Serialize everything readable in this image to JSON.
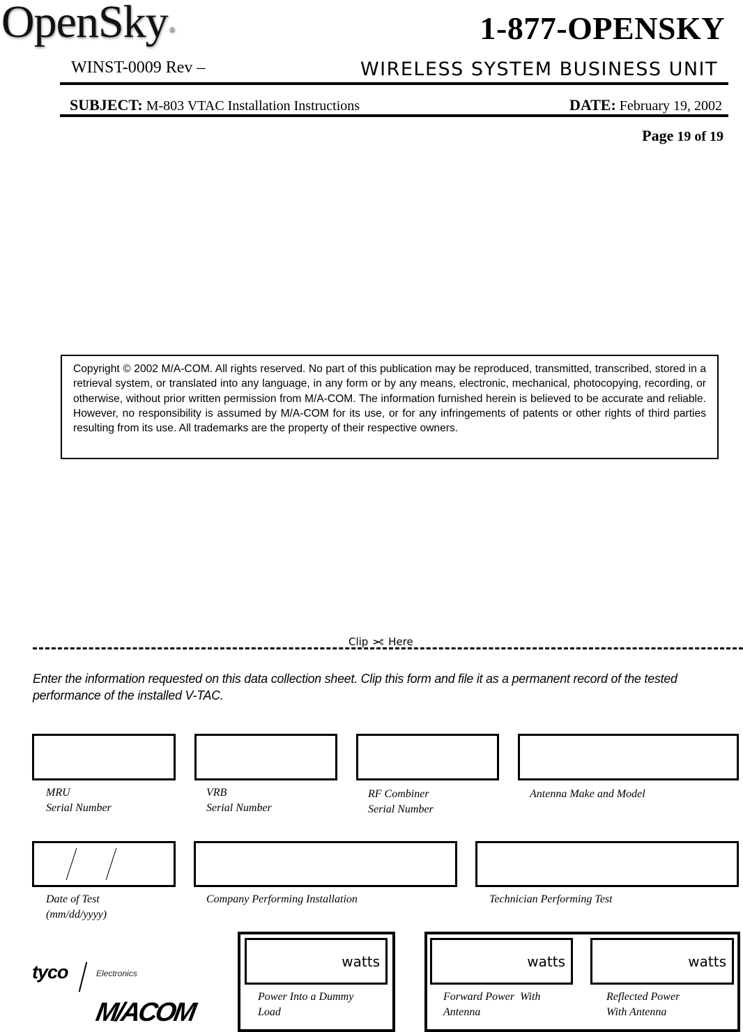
{
  "header": {
    "logo_text": "OpenSky",
    "logo_mark": "®",
    "phone": "1-877-OPENSKY",
    "doc_number": "WINST-0009 Rev –",
    "business_unit": "WIRELESS SYSTEM BUSINESS UNIT",
    "subject_label": "SUBJECT:",
    "subject_value": "M-803 VTAC Installation Instructions",
    "date_label": "DATE:",
    "date_value": "February 19, 2002",
    "page_label": "Page",
    "page_current": "19",
    "page_of": "of",
    "page_total": "19"
  },
  "copyright": {
    "text": "Copyright © 2002 M/A-COM. All rights reserved. No part of this publication may be reproduced, transmitted, transcribed, stored in a retrieval system, or translated into any language, in any form or by any means, electronic, mechanical, photocopying, recording, or otherwise, without prior written permission from M/A-COM. The information furnished herein is believed to be accurate and reliable. However, no responsibility is assumed by M/A-COM for its use, or for any infringements of patents or other rights of third parties resulting from its use. All trademarks are the property of their respective owners."
  },
  "clip": {
    "left": "Clip",
    "icon": "scissors-icon",
    "glyph": "✂",
    "right": "Here"
  },
  "instructions": "Enter the information requested on this data collection sheet. Clip this form and file it as a permanent record of the tested performance of the installed V-TAC.",
  "form": {
    "row1": [
      {
        "label_line1": "MRU",
        "label_line2": "Serial Number",
        "value": ""
      },
      {
        "label_line1": "VRB",
        "label_line2": "Serial Number",
        "value": ""
      },
      {
        "label_line1": "RF Combiner",
        "label_line2": "Serial Number",
        "value": ""
      },
      {
        "label_line1": "Antenna Make and Model",
        "label_line2": "",
        "value": ""
      }
    ],
    "row2": [
      {
        "label_line1": "Date of Test",
        "label_line2": "(mm/dd/yyyy)",
        "value": ""
      },
      {
        "label_line1": "Company Performing Installation",
        "label_line2": "",
        "value": ""
      },
      {
        "label_line1": "Technician Performing Test",
        "label_line2": "",
        "value": ""
      }
    ],
    "power": [
      {
        "unit": "watts",
        "label_line1": "Power Into a Dummy",
        "label_line2": "Load",
        "value": ""
      },
      {
        "unit": "watts",
        "label_line1": "Forward Power  With",
        "label_line2": "Antenna",
        "value": ""
      },
      {
        "unit": "watts",
        "label_line1": "Reflected Power",
        "label_line2": "With Antenna",
        "value": ""
      }
    ]
  },
  "logos": {
    "tyco": "tyco",
    "tyco_sub": "Electronics",
    "macom": "M/ACOM"
  }
}
